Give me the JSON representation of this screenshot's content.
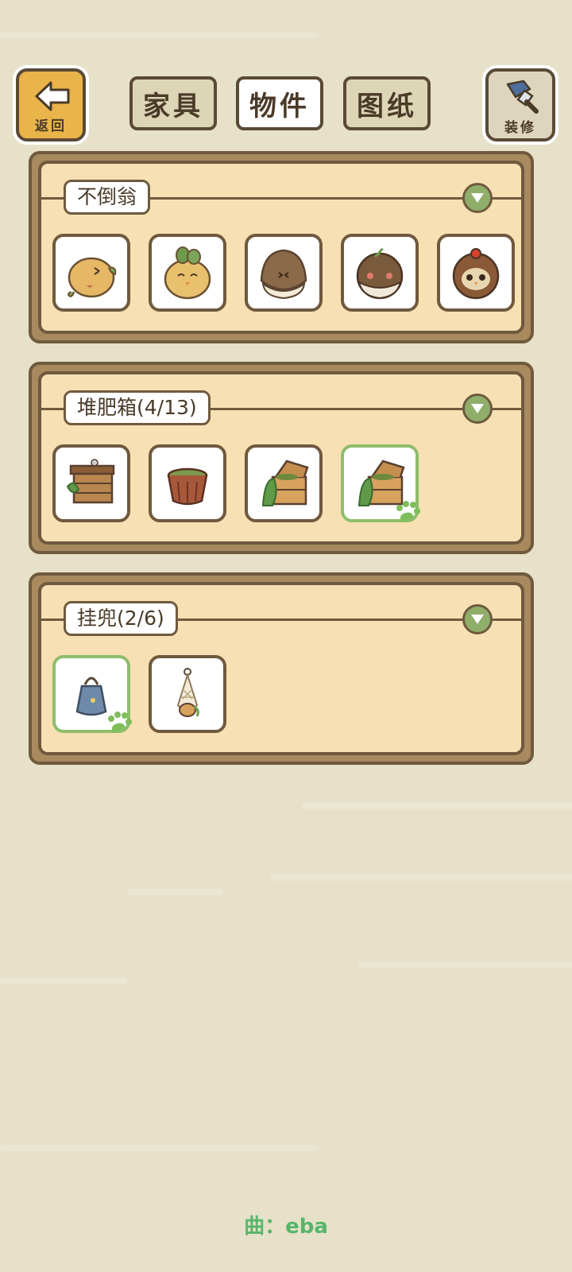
{
  "topbar": {
    "back_label": "返回",
    "decor_label": "装修",
    "tabs": [
      {
        "label": "家具",
        "active": false
      },
      {
        "label": "物件",
        "active": true
      },
      {
        "label": "图纸",
        "active": false
      }
    ]
  },
  "categories": [
    {
      "title": "不倒翁",
      "items": [
        {
          "icon": "tumbler-yellow-leaf-icon",
          "selected": false
        },
        {
          "icon": "tumbler-sprout-face-icon",
          "selected": false
        },
        {
          "icon": "tumbler-chestnut-icon",
          "selected": false
        },
        {
          "icon": "tumbler-dark-round-icon",
          "selected": false
        },
        {
          "icon": "tumbler-owl-icon",
          "selected": false
        }
      ]
    },
    {
      "title": "堆肥箱(4/13)",
      "items": [
        {
          "icon": "compost-crate-closed-icon",
          "selected": false
        },
        {
          "icon": "compost-bucket-icon",
          "selected": false
        },
        {
          "icon": "compost-box-open-icon",
          "selected": false
        },
        {
          "icon": "compost-box-open-icon",
          "selected": true
        }
      ]
    },
    {
      "title": "挂兜(2/6)",
      "items": [
        {
          "icon": "hanging-blue-pouch-icon",
          "selected": true
        },
        {
          "icon": "hanging-net-bag-icon",
          "selected": false
        }
      ]
    }
  ],
  "footer": {
    "credit": "曲：eba"
  },
  "colors": {
    "accent_green": "#8fbd6a",
    "panel_bg": "#f7e0b3",
    "frame": "#6f5a3e",
    "background": "#e6e1c8"
  }
}
